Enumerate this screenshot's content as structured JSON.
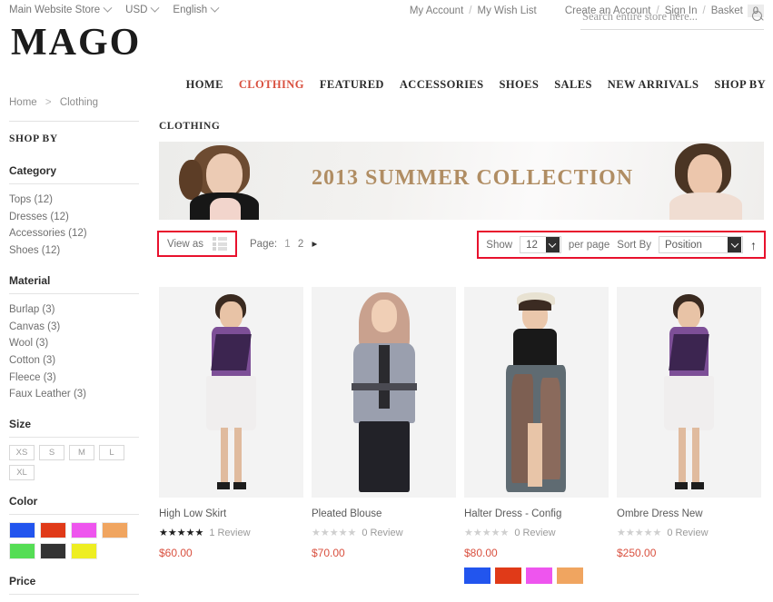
{
  "topbar": {
    "switchers": [
      {
        "label": "Main Website Store",
        "icon": "chevron-down-icon"
      },
      {
        "label": "USD",
        "icon": "chevron-down-icon"
      },
      {
        "label": "English",
        "icon": "chevron-down-icon"
      }
    ],
    "links": [
      "My Account",
      "My Wish List",
      "Create an Account",
      "Sign In",
      "Basket"
    ],
    "basket_count": "0"
  },
  "header": {
    "logo": "MAGO",
    "search": {
      "placeholder": "Search entire store here...",
      "value": "",
      "icon": "search-icon"
    }
  },
  "nav": {
    "items": [
      {
        "label": "HOME",
        "active": false
      },
      {
        "label": "CLOTHING",
        "active": true
      },
      {
        "label": "FEATURED",
        "active": false
      },
      {
        "label": "ACCESSORIES",
        "active": false
      },
      {
        "label": "SHOES",
        "active": false
      },
      {
        "label": "SALES",
        "active": false
      },
      {
        "label": "NEW ARRIVALS",
        "active": false
      },
      {
        "label": "SHOP BY",
        "active": false
      }
    ]
  },
  "breadcrumb": {
    "home": "Home",
    "current": "Clothing",
    "separator": ">"
  },
  "sidebar": {
    "shop_by": "SHOP BY",
    "category": {
      "title": "Category",
      "items": [
        "Tops (12)",
        "Dresses (12)",
        "Accessories (12)",
        "Shoes (12)"
      ]
    },
    "material": {
      "title": "Material",
      "items": [
        "Burlap (3)",
        "Canvas (3)",
        "Wool (3)",
        "Cotton (3)",
        "Fleece (3)",
        "Faux Leather (3)"
      ]
    },
    "size": {
      "title": "Size",
      "items": [
        "XS",
        "S",
        "M",
        "L",
        "XL"
      ]
    },
    "color": {
      "title": "Color",
      "items": [
        {
          "name": "blue",
          "hex": "#2255ee"
        },
        {
          "name": "red",
          "hex": "#e03a18"
        },
        {
          "name": "magenta",
          "hex": "#ee55ee"
        },
        {
          "name": "orange",
          "hex": "#f0a560"
        },
        {
          "name": "green",
          "hex": "#55dd55"
        },
        {
          "name": "black",
          "hex": "#333333"
        },
        {
          "name": "yellow",
          "hex": "#eeee22"
        }
      ]
    },
    "price": {
      "title": "Price"
    }
  },
  "content": {
    "category_title": "CLOTHING",
    "banner": {
      "text": "2013  SUMMER COLLECTION"
    },
    "toolbar": {
      "view_as_label": "View as",
      "grid_icon": "grid-view-icon",
      "list_icon": "list-view-icon",
      "page_label": "Page:",
      "pages": [
        "1",
        "2"
      ],
      "next_icon": "next-page-icon",
      "show_label": "Show",
      "show_value": "12",
      "per_page_label": "per page",
      "sort_label": "Sort By",
      "sort_value": "Position",
      "sort_direction_icon": "sort-ascending-icon"
    },
    "products": [
      {
        "name": "High Low Skirt",
        "rating": 5,
        "reviews": "1 Review",
        "price": "$60.00",
        "colors": []
      },
      {
        "name": "Pleated Blouse",
        "rating": 0,
        "reviews": "0 Review",
        "price": "$70.00",
        "colors": []
      },
      {
        "name": "Halter Dress - Config",
        "rating": 0,
        "reviews": "0 Review",
        "price": "$80.00",
        "colors": [
          "#2255ee",
          "#e03a18",
          "#ee55ee",
          "#f0a560"
        ]
      },
      {
        "name": "Ombre Dress New",
        "rating": 0,
        "reviews": "0 Review",
        "price": "$250.00",
        "colors": []
      }
    ]
  },
  "colors": {
    "accent": "#d9503f",
    "highlight_box": "#e8112d",
    "banner_text": "#b08d63"
  }
}
